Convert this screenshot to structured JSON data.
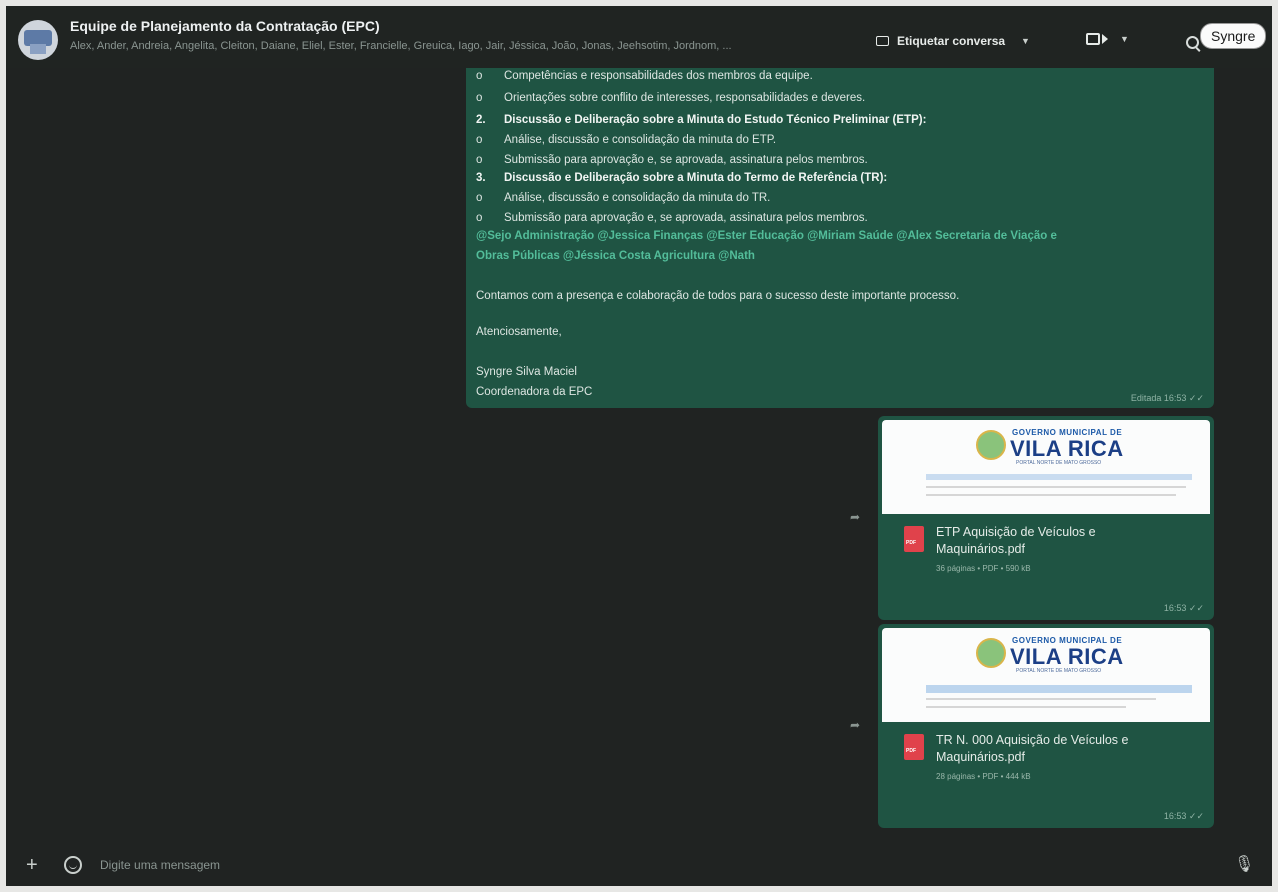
{
  "header": {
    "title": "Equipe de Planejamento da Contratação (EPC)",
    "members": "Alex, Ander, Andreia, Angelita, Cleiton, Daiane, Eliel, Ester, Francielle, Greuica, Iago, Jair, Jéssica, João, Jonas, Jeehsotim, Jordnom, ...",
    "label_button": "Etiquetar conversa",
    "user_name": "Syngre"
  },
  "message": {
    "lines": [
      {
        "num": "o",
        "text": "Competências e responsabilidades dos membros da equipe.",
        "bold": false
      },
      {
        "num": "o",
        "text": "Orientações sobre conflito de interesses, responsabilidades e deveres.",
        "bold": false
      },
      {
        "num": "2.",
        "text": "Discussão e Deliberação sobre a Minuta do Estudo Técnico Preliminar (ETP):",
        "bold": true
      },
      {
        "num": "o",
        "text": "Análise, discussão e consolidação da minuta do ETP.",
        "bold": false
      },
      {
        "num": "o",
        "text": "Submissão para aprovação e, se aprovada, assinatura pelos membros.",
        "bold": false
      },
      {
        "num": "3.",
        "text": "Discussão e Deliberação sobre a Minuta do Termo de Referência (TR):",
        "bold": true
      },
      {
        "num": "o",
        "text": "Análise, discussão e consolidação da minuta do TR.",
        "bold": false
      },
      {
        "num": "o",
        "text": "Submissão para aprovação e, se aprovada, assinatura pelos membros.",
        "bold": false
      }
    ],
    "mentions_1": "@Sejo Administração  @Jessica Finanças  @Ester Educação  @Miriam Saúde  @Alex Secretaria de Viação e",
    "mentions_2": "Obras Públicas  @Jéssica Costa Agricultura  @Nath",
    "closing": "Contamos com a presença e colaboração de todos para o sucesso deste importante processo.",
    "greeting": "Atenciosamente,",
    "signature_name": "Syngre Silva Maciel",
    "signature_role": "Coordenadora da EPC",
    "meta": "Editada 16:53 ✓✓"
  },
  "documents": [
    {
      "logo_top": "GOVERNO MUNICIPAL DE",
      "logo_main": "VILA RICA",
      "logo_sub": "PORTAL NORTE DE MATO GROSSO",
      "name": "ETP Aquisição de Veículos e Maquinários.pdf",
      "info": "36 páginas • PDF • 590 kB",
      "time": "16:53 ✓✓"
    },
    {
      "logo_top": "GOVERNO MUNICIPAL DE",
      "logo_main": "VILA RICA",
      "logo_sub": "PORTAL NORTE DE MATO GROSSO",
      "name": "TR N. 000 Aquisição de Veículos e Maquinários.pdf",
      "info": "28 páginas • PDF • 444 kB",
      "time": "16:53 ✓✓"
    }
  ],
  "footer": {
    "placeholder": "Digite uma mensagem"
  }
}
